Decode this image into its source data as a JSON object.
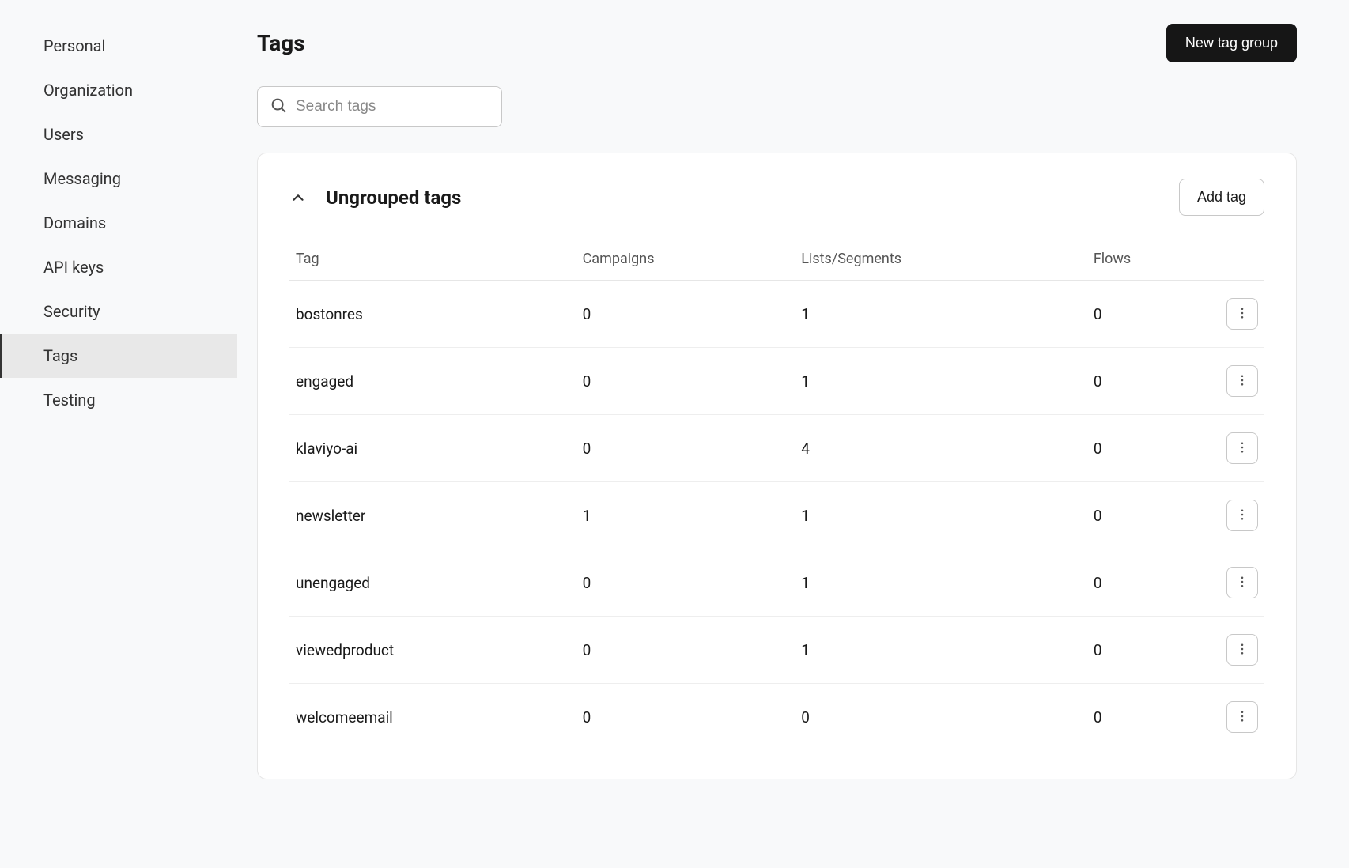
{
  "sidebar": {
    "items": [
      {
        "label": "Personal",
        "active": false
      },
      {
        "label": "Organization",
        "active": false
      },
      {
        "label": "Users",
        "active": false
      },
      {
        "label": "Messaging",
        "active": false
      },
      {
        "label": "Domains",
        "active": false
      },
      {
        "label": "API keys",
        "active": false
      },
      {
        "label": "Security",
        "active": false
      },
      {
        "label": "Tags",
        "active": true
      },
      {
        "label": "Testing",
        "active": false
      }
    ]
  },
  "header": {
    "title": "Tags",
    "new_group_label": "New tag group"
  },
  "search": {
    "placeholder": "Search tags",
    "value": ""
  },
  "group": {
    "title": "Ungrouped tags",
    "add_tag_label": "Add tag"
  },
  "table": {
    "columns": [
      "Tag",
      "Campaigns",
      "Lists/Segments",
      "Flows"
    ],
    "rows": [
      {
        "tag": "bostonres",
        "campaigns": "0",
        "lists": "1",
        "flows": "0"
      },
      {
        "tag": "engaged",
        "campaigns": "0",
        "lists": "1",
        "flows": "0"
      },
      {
        "tag": "klaviyo-ai",
        "campaigns": "0",
        "lists": "4",
        "flows": "0"
      },
      {
        "tag": "newsletter",
        "campaigns": "1",
        "lists": "1",
        "flows": "0"
      },
      {
        "tag": "unengaged",
        "campaigns": "0",
        "lists": "1",
        "flows": "0"
      },
      {
        "tag": "viewedproduct",
        "campaigns": "0",
        "lists": "1",
        "flows": "0"
      },
      {
        "tag": "welcomeemail",
        "campaigns": "0",
        "lists": "0",
        "flows": "0"
      }
    ]
  }
}
